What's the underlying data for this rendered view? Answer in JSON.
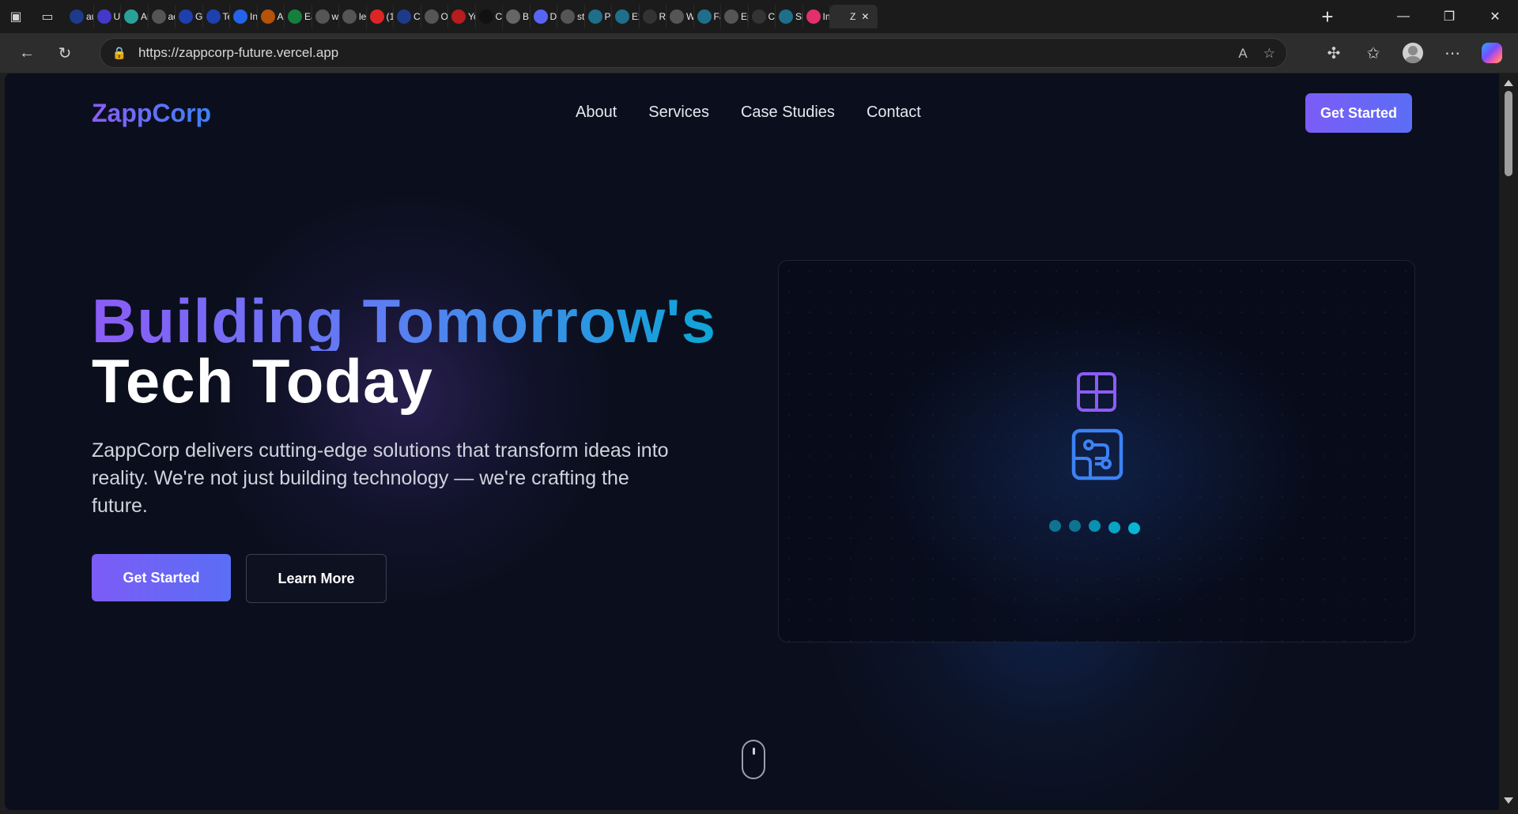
{
  "browser": {
    "tabs": [
      {
        "label": "au",
        "color": "#1e3a8a"
      },
      {
        "label": "Ui",
        "color": "#4338ca"
      },
      {
        "label": "An",
        "color": "#2aa198",
        "active": false
      },
      {
        "label": "ac",
        "color": "#555"
      },
      {
        "label": "G",
        "color": "#1e40af"
      },
      {
        "label": "Te",
        "color": "#1e40af"
      },
      {
        "label": "In",
        "color": "#2563eb"
      },
      {
        "label": "A",
        "color": "#b45309"
      },
      {
        "label": "Ea",
        "color": "#15803d"
      },
      {
        "label": "w",
        "color": "#555"
      },
      {
        "label": "le",
        "color": "#555"
      },
      {
        "label": "(1",
        "color": "#dc2626"
      },
      {
        "label": "C(",
        "color": "#1e3a8a"
      },
      {
        "label": "O",
        "color": "#555"
      },
      {
        "label": "Yo",
        "color": "#b91c1c"
      },
      {
        "label": "C(",
        "color": "#111"
      },
      {
        "label": "B",
        "color": "#666"
      },
      {
        "label": "D",
        "color": "#5865f2"
      },
      {
        "label": "st",
        "color": "#555"
      },
      {
        "label": "Pa",
        "color": "#1f6f8b"
      },
      {
        "label": "Ex",
        "color": "#1f6f8b"
      },
      {
        "label": "Re",
        "color": "#333"
      },
      {
        "label": "W",
        "color": "#555"
      },
      {
        "label": "Fa",
        "color": "#1f6f8b"
      },
      {
        "label": "Ep",
        "color": "#555"
      },
      {
        "label": "C(",
        "color": "#333"
      },
      {
        "label": "Sl",
        "color": "#1f6f8b"
      },
      {
        "label": "In",
        "color": "#e1306c"
      },
      {
        "label": "Z",
        "color": "#2d2d2d",
        "active": true
      }
    ],
    "url": "https://zappcorp-future.vercel.app"
  },
  "site": {
    "logo": "ZappCorp",
    "nav": [
      "About",
      "Services",
      "Case Studies",
      "Contact"
    ],
    "nav_cta": "Get Started",
    "hero": {
      "title_line1": "Building Tomorrow's",
      "title_line2": "Tech Today",
      "lead": "ZappCorp delivers cutting-edge solutions that transform ideas into reality. We're not just building technology — we're crafting the future.",
      "primary_cta": "Get Started",
      "secondary_cta": "Learn More"
    }
  },
  "colors": {
    "accent_purple": "#8b5cf6",
    "accent_blue": "#3b82f6",
    "accent_cyan": "#06b6d4",
    "page_bg": "#0b0f1d"
  }
}
